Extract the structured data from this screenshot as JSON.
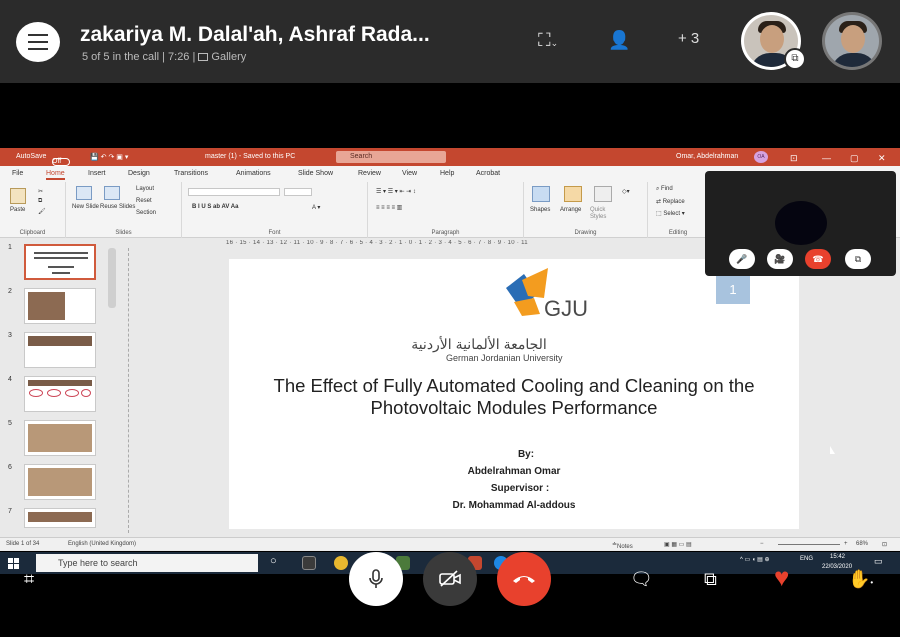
{
  "call": {
    "title": "zakariya M. Dalal'ah, Ashraf Rada...",
    "subtitle": "5 of 5 in the call | 7:26 |",
    "view_label": "Gallery",
    "add_count": "+ 3"
  },
  "ppt": {
    "autosave": "AutoSave",
    "autosave_state": "Off",
    "doc_title": "master (1) - Saved to this PC",
    "search_placeholder": "Search",
    "user_name": "Omar, Abdelrahman",
    "user_initials": "OA",
    "tabs": [
      "File",
      "Home",
      "Insert",
      "Design",
      "Transitions",
      "Animations",
      "Slide Show",
      "Review",
      "View",
      "Help",
      "Acrobat"
    ],
    "active_tab": "Home",
    "ribbon_groups": {
      "clipboard": "Clipboard",
      "slides": "Slides",
      "font": "Font",
      "paragraph": "Paragraph",
      "drawing": "Drawing",
      "editing": "Editing"
    },
    "ribbon_items": {
      "paste": "Paste",
      "new_slide": "New Slide",
      "reuse_slides": "Reuse Slides",
      "layout": "Layout",
      "reset": "Reset",
      "section": "Section",
      "shapes": "Shapes",
      "arrange": "Arrange",
      "quick_styles": "Quick Styles",
      "find": "Find",
      "replace": "Replace",
      "select": "Select"
    },
    "ruler": "16 · 15 · 14 · 13 · 12 · 11 · 10 · 9 · 8 · 7 · 6 · 5 · 4 · 3 · 2 · 1 · 0 · 1 · 2 · 3 · 4 · 5 · 6 · 7 · 8 · 9 · 10 · 11",
    "thumb_numbers": [
      "1",
      "2",
      "3",
      "4",
      "5",
      "6",
      "7"
    ],
    "slide": {
      "logo_text": "GJU",
      "arabic_name": "الجامعة الألمانية الأردنية",
      "english_name": "German Jordanian University",
      "title": "The Effect of Fully Automated Cooling and Cleaning on the Photovoltaic Modules Performance",
      "by": "By:",
      "author": "Abdelrahman Omar",
      "supervisor_label": "Supervisor :",
      "supervisor": "Dr. Mohammad Al-addous",
      "number": "1"
    },
    "status": {
      "slide_count": "Slide 1 of 34",
      "language": "English (United Kingdom)",
      "notes": "Notes",
      "zoom": "68%"
    }
  },
  "taskbar": {
    "search_placeholder": "Type here to search",
    "language": "ENG",
    "time": "15:42",
    "date": "22/03/2020"
  },
  "colors": {
    "ppt_accent": "#c4472f",
    "end_call": "#e8412d",
    "gju_orange": "#f39c1f",
    "gju_blue": "#2a6db5"
  }
}
